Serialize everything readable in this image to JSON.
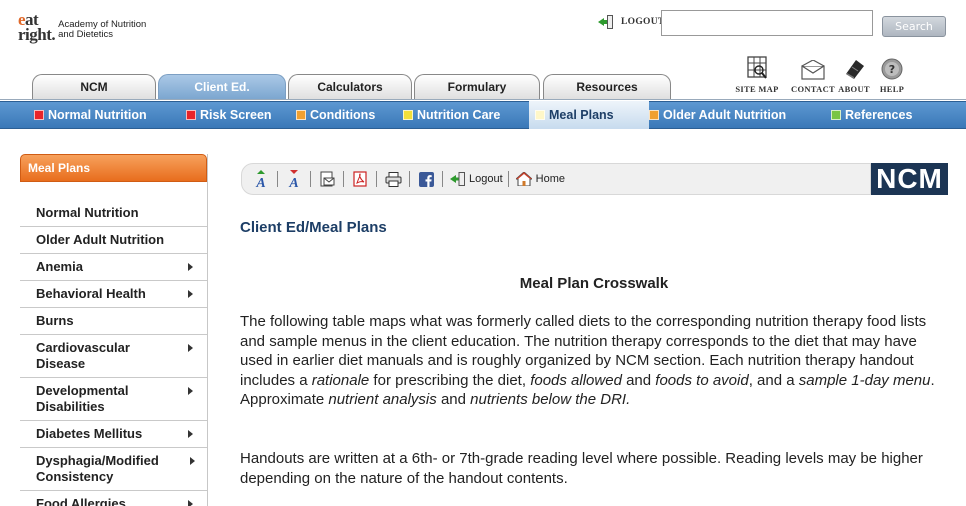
{
  "header": {
    "logo_mark_e": "e",
    "logo_mark_at": "at",
    "logo_mark_right": "right.",
    "logo_line1": "Academy of Nutrition",
    "logo_line2": "and Dietetics",
    "logout_label": "LOGOUT",
    "search_value": "",
    "search_button": "Search"
  },
  "utility": {
    "sitemap": "SITE MAP",
    "contact": "CONTACT",
    "about": "ABOUT",
    "help": "HELP"
  },
  "tabs": [
    {
      "label": "NCM"
    },
    {
      "label": "Client Ed."
    },
    {
      "label": "Calculators"
    },
    {
      "label": "Formulary"
    },
    {
      "label": "Resources"
    }
  ],
  "subnav": [
    {
      "label": "Normal Nutrition",
      "color": "#e8242a"
    },
    {
      "label": "Risk Screen",
      "color": "#e8242a"
    },
    {
      "label": "Conditions",
      "color": "#f0a030"
    },
    {
      "label": "Nutrition Care",
      "color": "#f2e03a"
    },
    {
      "label": "Meal Plans",
      "color": "#fff7c8"
    },
    {
      "label": "Older Adult Nutrition",
      "color": "#f0a030"
    },
    {
      "label": "References",
      "color": "#79c544"
    }
  ],
  "sidebar": {
    "title": "Meal Plans",
    "items": [
      {
        "label": "Normal Nutrition"
      },
      {
        "label": "Older Adult Nutrition"
      },
      {
        "label": "Anemia"
      },
      {
        "label": "Behavioral Health"
      },
      {
        "label": "Burns"
      },
      {
        "label": "Cardiovascular Disease"
      },
      {
        "label": "Developmental Disabilities"
      },
      {
        "label": "Diabetes Mellitus"
      },
      {
        "label": "Dysphagia/Modified Consistency"
      },
      {
        "label": "Food Allergies"
      }
    ]
  },
  "toolbar": {
    "logout": "Logout",
    "home": "Home"
  },
  "ncm_logo": "NCM",
  "main": {
    "breadcrumb": "Client Ed/Meal Plans",
    "heading": "Meal Plan Crosswalk",
    "p1_a": "The following table maps what was formerly called diets to the corresponding nutrition therapy food lists and sample menus in the client education. The nutrition therapy corresponds to the diet that may have used in earlier diet manuals and is roughly organized by NCM section. Each nutrition therapy handout includes a ",
    "p1_rationale": "rationale",
    "p1_b": " for prescribing the diet, ",
    "p1_allowed": "foods allowed",
    "p1_c": " and ",
    "p1_avoid": "foods to avoid",
    "p1_d": ", and a ",
    "p1_menu": "sample 1-day menu",
    "p1_e": ". Approximate ",
    "p1_analysis": "nutrient analysis",
    "p1_f": " and ",
    "p1_dri": "nutrients below the DRI.",
    "p2": "Handouts are written at a 6th- or 7th-grade reading level where possible. Reading levels may be higher depending on the nature of the handout contents."
  }
}
